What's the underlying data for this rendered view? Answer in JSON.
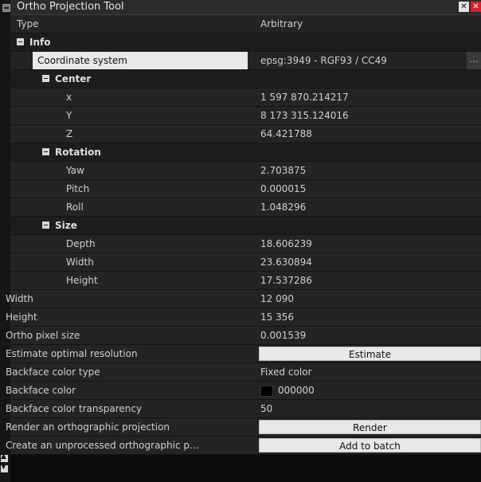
{
  "window": {
    "title": "Ortho Projection Tool",
    "float_glyph": "✕",
    "close_glyph": "✕"
  },
  "properties": {
    "type": {
      "label": "Type",
      "value": "Arbitrary"
    },
    "info_title": "Info",
    "coordinate_system": {
      "label": "Coordinate system",
      "value": "epsg:3949 - RGF93 / CC49",
      "button": "..."
    },
    "center_title": "Center",
    "center": [
      {
        "label": "x",
        "value": "1 597 870.214217"
      },
      {
        "label": "Y",
        "value": "8 173 315.124016"
      },
      {
        "label": "Z",
        "value": "64.421788"
      }
    ],
    "rotation_title": "Rotation",
    "rotation": [
      {
        "label": "Yaw",
        "value": "2.703875"
      },
      {
        "label": "Pitch",
        "value": "0.000015"
      },
      {
        "label": "Roll",
        "value": "1.048296"
      }
    ],
    "size_title": "Size",
    "size": [
      {
        "label": "Depth",
        "value": "18.606239"
      },
      {
        "label": "Width",
        "value": "23.630894"
      },
      {
        "label": "Height",
        "value": "17.537286"
      }
    ],
    "width": {
      "label": "Width",
      "value": "12 090"
    },
    "height": {
      "label": "Height",
      "value": "15 356"
    },
    "ortho_pixel_size": {
      "label": "Ortho pixel size",
      "value": "0.001539"
    },
    "estimate": {
      "label": "Estimate optimal resolution",
      "button": "Estimate"
    },
    "backface_type": {
      "label": "Backface color type",
      "value": "Fixed color"
    },
    "backface_color": {
      "label": "Backface color",
      "value": "000000",
      "swatch": "#000000"
    },
    "backface_transparency": {
      "label": "Backface color transparency",
      "value": "50"
    },
    "render": {
      "label": "Render an orthographic projection",
      "button": "Render"
    },
    "batch": {
      "label": "Create an unprocessed orthographic p...",
      "button": "Add to batch"
    }
  },
  "colors": {
    "background": "#0b0b0b",
    "row": "#242424",
    "section": "#1d1d1d",
    "selection": "#e8e8e8",
    "close": "#d2222b"
  }
}
